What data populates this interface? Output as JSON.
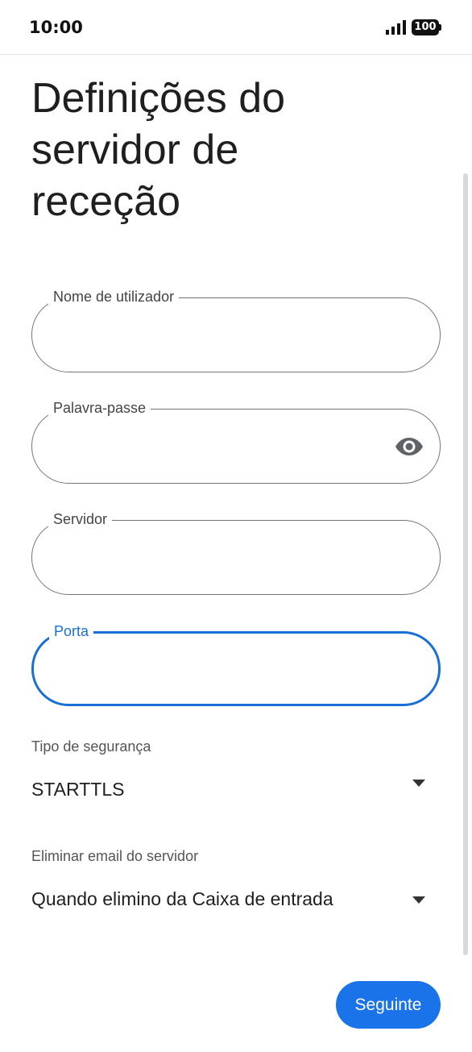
{
  "status_bar": {
    "time": "10:00",
    "battery": "100",
    "icons": [
      "signal-icon",
      "battery-icon"
    ]
  },
  "title": "Definições do\nservidor de\nreceção",
  "fields": {
    "username": {
      "label": "Nome de utilizador",
      "value": "",
      "focused": false
    },
    "password": {
      "label": "Palavra-passe",
      "value": "",
      "focused": false,
      "icon": "eye-icon"
    },
    "server": {
      "label": "Servidor",
      "value": "",
      "focused": false
    },
    "port": {
      "label": "Porta",
      "value": "",
      "focused": true
    }
  },
  "security_type": {
    "label": "Tipo de segurança",
    "selected": "STARTTLS",
    "icon": "dropdown-arrow-icon"
  },
  "delete_email": {
    "label": "Eliminar email do servidor",
    "selected": "Quando elimino da Caixa de entrada",
    "icon": "dropdown-arrow-icon"
  },
  "next_button": {
    "label": "Seguinte"
  },
  "colors": {
    "accent": "#1a73e8",
    "focus_border": "#1a6fd6",
    "field_border": "#757575",
    "text": "#1f1f1f"
  }
}
